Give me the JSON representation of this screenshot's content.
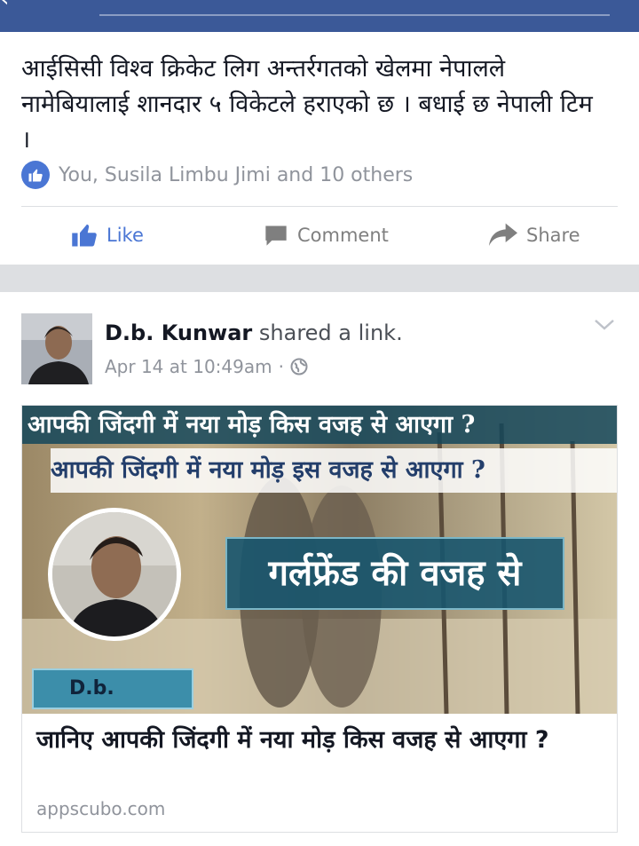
{
  "post1": {
    "text": "आईसिसी विश्व क्रिकेट लिग अन्तर्रगतको खेलमा नेपालले नामेबियालाई शानदार ५ विकेटले हराएको छ । बधाई छ नेपाली टिम ।",
    "reactions": "You, Susila Limbu Jimi and 10 others",
    "actions": {
      "like": "Like",
      "comment": "Comment",
      "share": "Share"
    }
  },
  "post2": {
    "author": "D.b. Kunwar",
    "action_text": "shared a link.",
    "date": "Apr 14 at 10:49am",
    "privacy_icon": "globe-icon",
    "link": {
      "image_line1": "आपकी जिंदगी में नया मोड़ किस वजह से आएगा ?",
      "image_line2": "आपकी जिंदगी में नया मोड़ इस वजह से आएगा ?",
      "image_box": "गर्लफ्रेंड की वजह से",
      "image_name": "D.b.",
      "title": "जानिए आपकी जिंदगी में नया मोड़ किस वजह से आएगा ?",
      "domain": "appscubo.com"
    }
  },
  "colors": {
    "brand": "#3b5998",
    "like_blue": "#4a76d4",
    "muted": "#90949c"
  }
}
